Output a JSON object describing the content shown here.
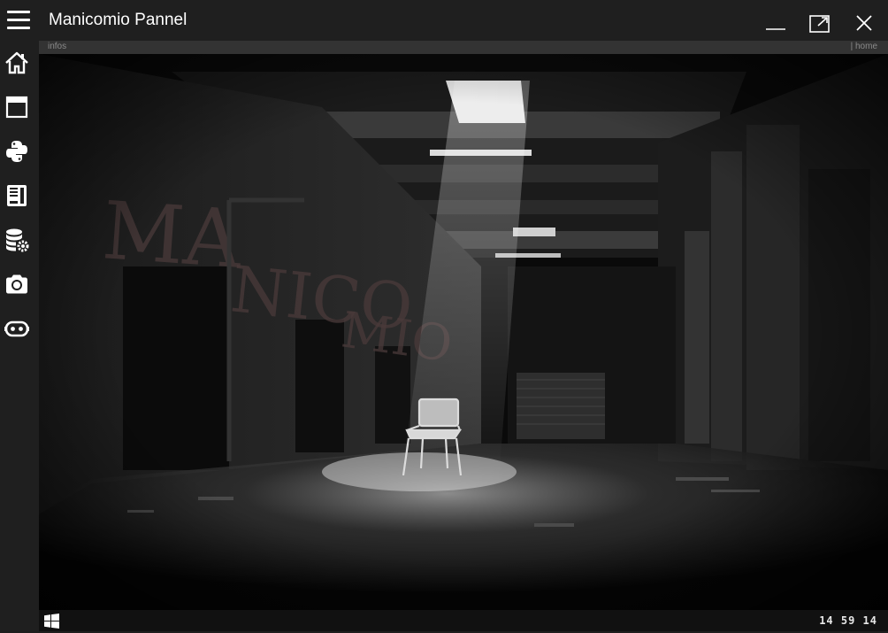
{
  "window": {
    "title": "Manicomio Pannel"
  },
  "titlebar": {
    "menu_icon": "hamburger-menu-icon",
    "controls": [
      "minimize-icon",
      "maximize-icon",
      "close-icon"
    ]
  },
  "sidebar": {
    "items": [
      {
        "icon": "home-icon"
      },
      {
        "icon": "browser-window-icon"
      },
      {
        "icon": "python-icon"
      },
      {
        "icon": "book-icon"
      },
      {
        "icon": "database-settings-icon"
      },
      {
        "icon": "camera-icon"
      },
      {
        "icon": "robot-icon"
      }
    ]
  },
  "infobar": {
    "left_text": "infos",
    "right_text": "| home"
  },
  "main": {
    "background_image": "dark abandoned asylum corridor with a single chair under a light beam",
    "wall_graffiti": "MANICOMIO"
  },
  "taskbar": {
    "start_icon": "windows-logo-icon",
    "clock": "14 59 14"
  },
  "colors": {
    "titlebar_bg": "#1f1f1f",
    "infobar_bg": "#333333",
    "taskbar_bg": "#111111",
    "text": "#ffffff"
  }
}
